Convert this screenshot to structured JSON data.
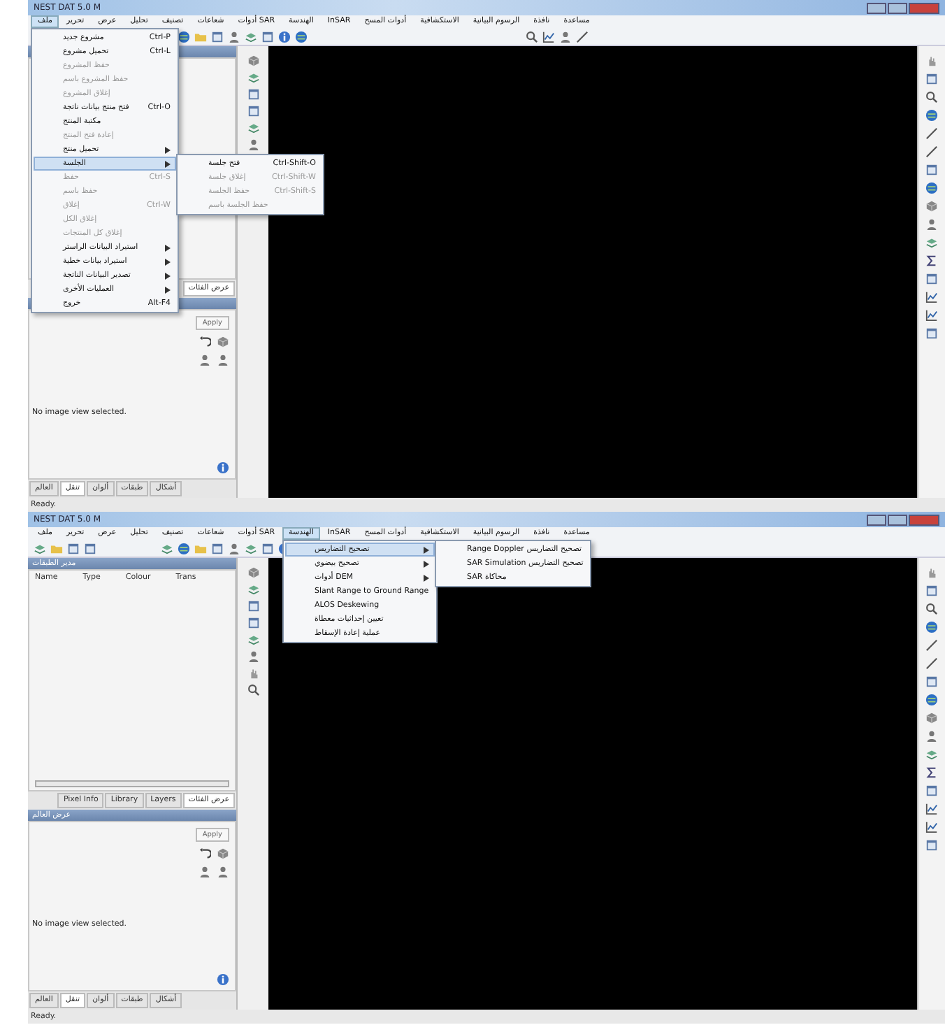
{
  "windows": [
    {
      "title": "NEST DAT 5.0 M",
      "menu": [
        {
          "label": "مساعدة",
          "selected": false
        },
        {
          "label": "نافذة",
          "selected": false
        },
        {
          "label": "الرسوم البيانية",
          "selected": false
        },
        {
          "label": "الاستكشافية",
          "selected": false
        },
        {
          "label": "أدوات المسح",
          "selected": false
        },
        {
          "label": "InSAR",
          "selected": false
        },
        {
          "label": "الهندسة",
          "selected": false
        },
        {
          "label": "أدوات SAR",
          "selected": false
        },
        {
          "label": "شعاعات",
          "selected": false
        },
        {
          "label": "تصنيف",
          "selected": false
        },
        {
          "label": "تحليل",
          "selected": false
        },
        {
          "label": "عرض",
          "selected": false
        },
        {
          "label": "تحرير",
          "selected": false
        },
        {
          "label": "ملف",
          "selected": true
        }
      ],
      "dropdown": {
        "items": [
          {
            "label": "مشروع جديد",
            "shortcut": "Ctrl-P",
            "disabled": false,
            "has_submenu": false,
            "selected": false
          },
          {
            "label": "تحميل مشروع",
            "shortcut": "Ctrl-L",
            "disabled": false,
            "has_submenu": false,
            "selected": false
          },
          {
            "label": "حفظ المشروع",
            "disabled": true,
            "has_submenu": false,
            "selected": false
          },
          {
            "label": "حفظ المشروع باسم",
            "disabled": true,
            "has_submenu": false,
            "selected": false
          },
          {
            "label": "إغلاق المشروع",
            "disabled": true,
            "has_submenu": false,
            "selected": false
          },
          {
            "label": "فتح منتج بيانات ناتجة",
            "shortcut": "Ctrl-O",
            "disabled": false,
            "has_submenu": false,
            "selected": false
          },
          {
            "label": "مكتبة المنتج",
            "disabled": false,
            "has_submenu": false,
            "selected": false
          },
          {
            "label": "إعادة فتح المنتج",
            "disabled": true,
            "has_submenu": false,
            "selected": false
          },
          {
            "label": "تحميل منتج",
            "disabled": false,
            "has_submenu": true,
            "selected": false
          },
          {
            "label": "الجلسة",
            "disabled": false,
            "has_submenu": true,
            "selected": true
          },
          {
            "label": "حفظ",
            "shortcut": "Ctrl-S",
            "disabled": true,
            "has_submenu": false,
            "selected": false
          },
          {
            "label": "حفظ باسم",
            "disabled": true,
            "has_submenu": false,
            "selected": false
          },
          {
            "label": "إغلاق",
            "shortcut": "Ctrl-W",
            "disabled": true,
            "has_submenu": false,
            "selected": false
          },
          {
            "label": "إغلاق الكل",
            "disabled": true,
            "has_submenu": false,
            "selected": false
          },
          {
            "label": "إغلاق كل المنتجات",
            "disabled": true,
            "has_submenu": false,
            "selected": false
          },
          {
            "label": "استيراد البيانات الراستر",
            "disabled": false,
            "has_submenu": true,
            "selected": false
          },
          {
            "label": "استيراد بيانات خطية",
            "disabled": false,
            "has_submenu": true,
            "selected": false
          },
          {
            "label": "تصدير البيانات الناتجة",
            "disabled": false,
            "has_submenu": true,
            "selected": false
          },
          {
            "label": "العمليات الأخرى",
            "disabled": false,
            "has_submenu": true,
            "selected": false
          },
          {
            "label": "خروج",
            "shortcut": "Alt-F4",
            "disabled": false,
            "has_submenu": false,
            "selected": false
          }
        ],
        "submenu": [
          {
            "label": "فتح جلسة",
            "shortcut": "Ctrl-Shift-O",
            "disabled": false,
            "has_submenu": false,
            "selected": false
          },
          {
            "label": "إغلاق جلسة",
            "shortcut": "Ctrl-Shift-W",
            "disabled": true,
            "has_submenu": false,
            "selected": false
          },
          {
            "label": "حفظ الجلسة",
            "shortcut": "Ctrl-Shift-S",
            "disabled": true,
            "has_submenu": false,
            "selected": false
          },
          {
            "label": "حفظ الجلسة باسم",
            "disabled": true,
            "has_submenu": false,
            "selected": false
          }
        ]
      },
      "top_panel": {
        "tabs": [
          {
            "label": "عرض الفئات",
            "selected": true
          }
        ]
      },
      "bottom_panel": {
        "button": "Apply",
        "message": "No image view selected.",
        "tabs": [
          {
            "label": "أشكال",
            "selected": false
          },
          {
            "label": "طبقات",
            "selected": false
          },
          {
            "label": "ألوان",
            "selected": false
          },
          {
            "label": "تنقل",
            "selected": true
          },
          {
            "label": "العالم",
            "selected": false
          }
        ]
      },
      "status_bar": "Ready."
    },
    {
      "title": "NEST DAT 5.0 M",
      "menu": [
        {
          "label": "مساعدة",
          "selected": false
        },
        {
          "label": "نافذة",
          "selected": false
        },
        {
          "label": "الرسوم البيانية",
          "selected": false
        },
        {
          "label": "الاستكشافية",
          "selected": false
        },
        {
          "label": "أدوات المسح",
          "selected": false
        },
        {
          "label": "InSAR",
          "selected": false
        },
        {
          "label": "الهندسة",
          "selected": true
        },
        {
          "label": "أدوات SAR",
          "selected": false
        },
        {
          "label": "شعاعات",
          "selected": false
        },
        {
          "label": "تصنيف",
          "selected": false
        },
        {
          "label": "تحليل",
          "selected": false
        },
        {
          "label": "عرض",
          "selected": false
        },
        {
          "label": "تحرير",
          "selected": false
        },
        {
          "label": "ملف",
          "selected": false
        }
      ],
      "dropdown": {
        "items": [
          {
            "label": "تصحيح التضاريس",
            "disabled": false,
            "has_submenu": true,
            "selected": true
          },
          {
            "label": "تصحيح بيضوي",
            "disabled": false,
            "has_submenu": true,
            "selected": false
          },
          {
            "label": "أدوات DEM",
            "disabled": false,
            "has_submenu": true,
            "selected": false
          },
          {
            "label": "Slant Range to Ground Range",
            "disabled": false,
            "has_submenu": false,
            "selected": false
          },
          {
            "label": "ALOS Deskewing",
            "disabled": false,
            "has_submenu": false,
            "selected": false
          },
          {
            "label": "تعيين إحداثيات معطاة",
            "disabled": false,
            "has_submenu": false,
            "selected": false
          },
          {
            "label": "عملية إعادة الإسقاط",
            "disabled": false,
            "has_submenu": false,
            "selected": false
          }
        ],
        "submenu": [
          {
            "label": "Range Doppler تصحيح التضاريس",
            "disabled": false,
            "has_submenu": false,
            "selected": false
          },
          {
            "label": "SAR Simulation تصحيح التضاريس",
            "disabled": false,
            "has_submenu": false,
            "selected": false
          },
          {
            "label": "SAR محاكاة",
            "disabled": false,
            "has_submenu": false,
            "selected": false
          }
        ]
      },
      "top_panel": {
        "title": "مدير الطبقات",
        "columns": [
          "Trans",
          "Colour",
          "Type",
          "Name"
        ],
        "tabs": [
          {
            "label": "عرض الفئات",
            "selected": true
          },
          {
            "label": "Layers",
            "selected": false
          },
          {
            "label": "Library",
            "selected": false
          },
          {
            "label": "Pixel Info",
            "selected": false
          }
        ]
      },
      "bottom_panel": {
        "title": "عرض العالم",
        "button": "Apply",
        "message": "No image view selected.",
        "tabs": [
          {
            "label": "أشكال",
            "selected": false
          },
          {
            "label": "طبقات",
            "selected": false
          },
          {
            "label": "ألوان",
            "selected": false
          },
          {
            "label": "تنقل",
            "selected": true
          },
          {
            "label": "العالم",
            "selected": false
          }
        ]
      },
      "status_bar": "Ready."
    }
  ]
}
